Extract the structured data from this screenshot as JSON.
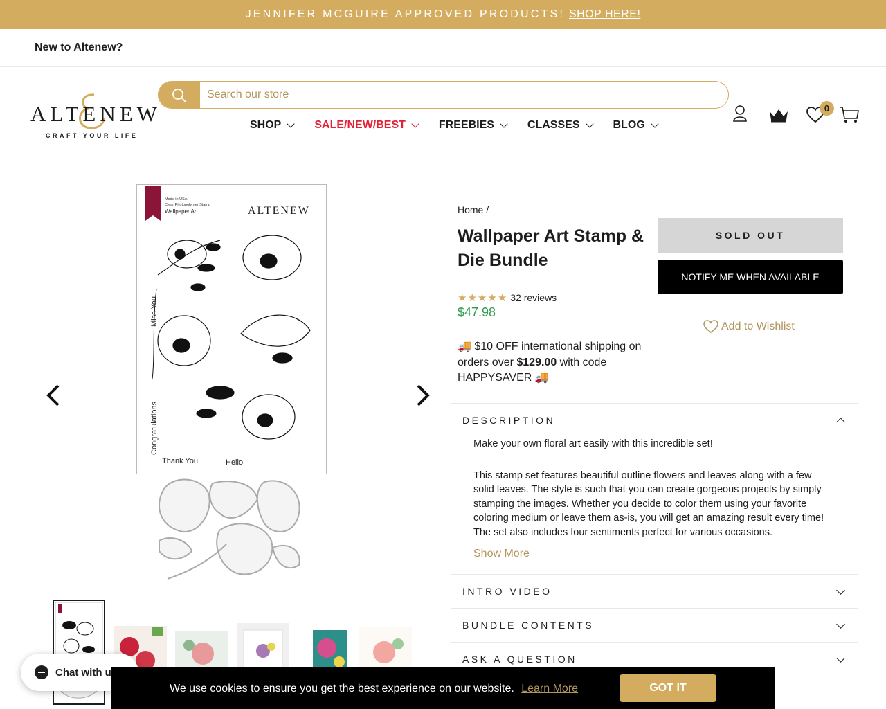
{
  "announcement": {
    "text": "JENNIFER MCGUIRE APPROVED PRODUCTS!",
    "link": "SHOP HERE!"
  },
  "topbar": {
    "new_to": "New to Altenew?"
  },
  "logo": {
    "word": "ALTENEW",
    "tagline": "CRAFT YOUR LIFE"
  },
  "search": {
    "placeholder": "Search our store"
  },
  "nav": [
    {
      "label": "SHOP"
    },
    {
      "label": "SALE/NEW/BEST"
    },
    {
      "label": "FREEBIES"
    },
    {
      "label": "CLASSES"
    },
    {
      "label": "BLOG"
    }
  ],
  "header": {
    "wishlist_count": "0",
    "cart_label": "CART"
  },
  "product": {
    "breadcrumb": "Home /",
    "title": "Wallpaper Art Stamp & Die Bundle",
    "rating": 5,
    "reviews": "32 reviews",
    "price": "$47.98",
    "shipping_pre": "$10 OFF international shipping on orders over",
    "shipping_amount": "$129.00",
    "shipping_post": "with code HAPPYSAVER",
    "soldout": "SOLD OUT",
    "notify": "NOTIFY ME WHEN AVAILABLE",
    "wishlist": "Add to Wishlist"
  },
  "image": {
    "stamp_header": "Made in USA\nClear Photopolymer Stamp",
    "stamp_name": "Wallpaper Art",
    "brand": "ALTENEW",
    "sentiments": [
      "Miss You",
      "Congratulations",
      "Thank You",
      "Hello"
    ]
  },
  "accordion": {
    "description": "DESCRIPTION",
    "desc_p1": "Make your own floral art easily with this incredible set!",
    "desc_p2": "This stamp set features beautiful outline flowers and leaves along with a few solid leaves. The style is such that you can create gorgeous projects by simply stamping the images. Whether you decide to color them using your favorite coloring medium or leave them as-is, you will get an amazing result every time! The set also includes four sentiments perfect for various occasions.",
    "show_more": "Show More",
    "intro_video": "INTRO VIDEO",
    "bundle_contents": "BUNDLE CONTENTS",
    "ask": "ASK A QUESTION"
  },
  "cookie": {
    "text": "We use cookies to ensure you get the best experience on our website.",
    "learn": "Learn More",
    "button": "GOT IT"
  },
  "chat": {
    "label": "Chat with us"
  },
  "colors": {
    "gold": "#d3ac5f",
    "sale": "#e41f36",
    "price": "#2e9b4e"
  }
}
